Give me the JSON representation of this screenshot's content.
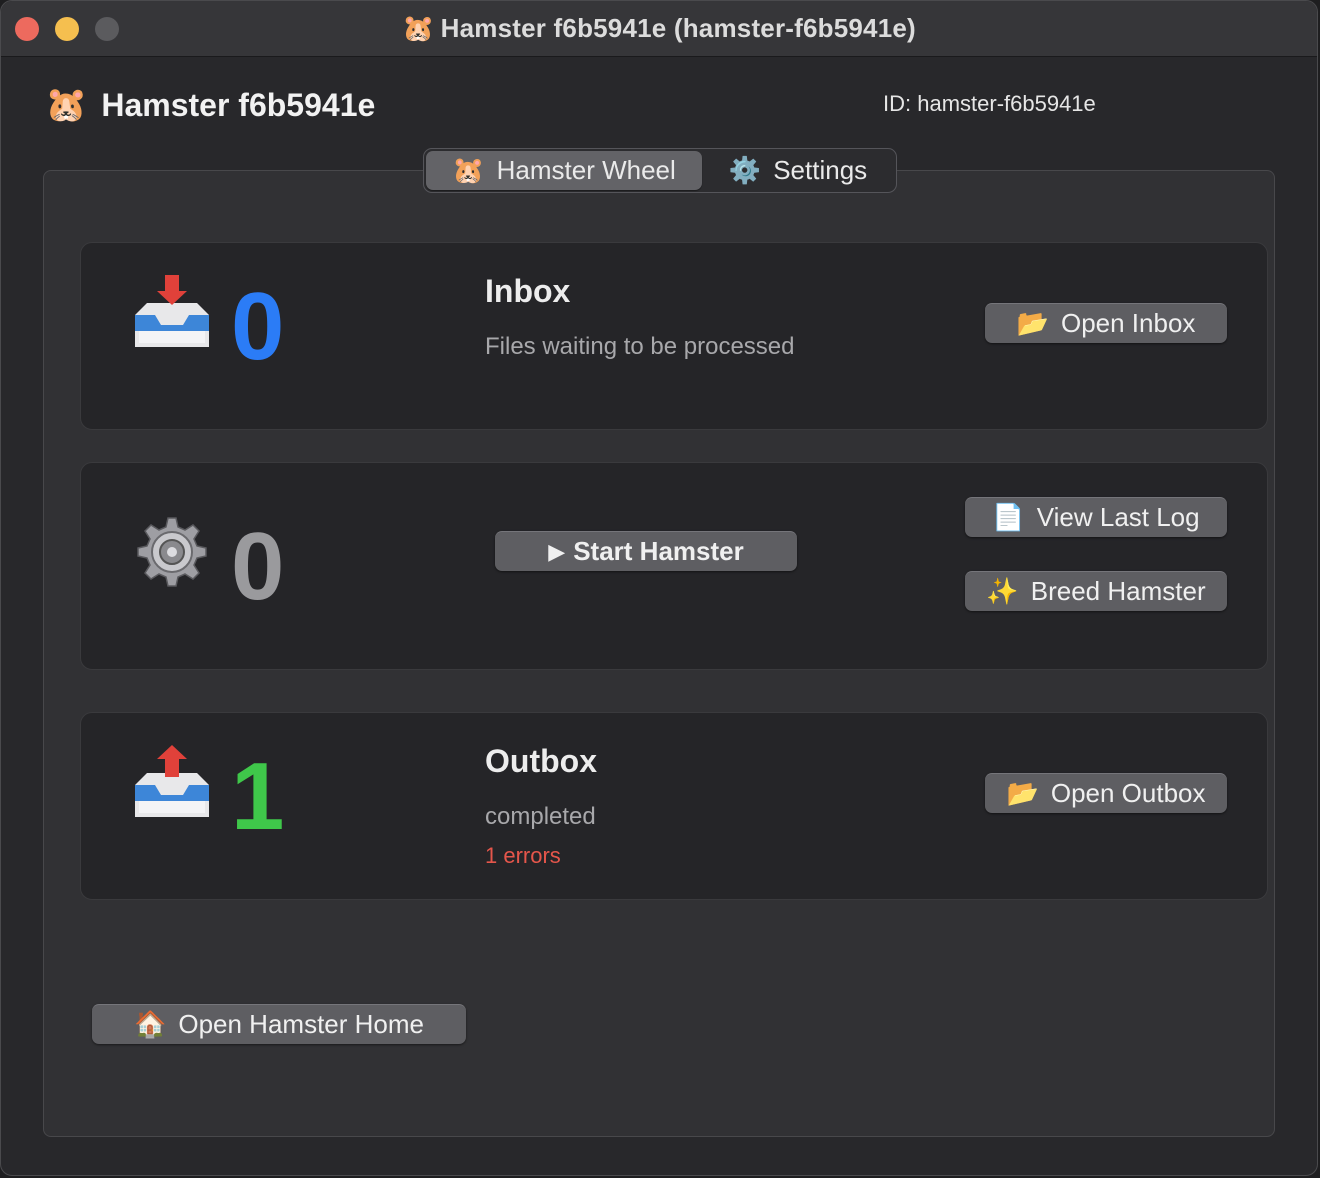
{
  "window": {
    "title": "Hamster f6b5941e (hamster-f6b5941e)",
    "title_icon": "🐹"
  },
  "header": {
    "icon": "🐹",
    "name": "Hamster f6b5941e",
    "id_label": "ID: hamster-f6b5941e"
  },
  "tabs": [
    {
      "icon": "🐹",
      "label": "Hamster Wheel",
      "active": true
    },
    {
      "icon": "⚙️",
      "label": "Settings",
      "active": false
    }
  ],
  "inbox": {
    "icon": "inbox-tray-icon",
    "count": "0",
    "count_color": "#2b7cf6",
    "title": "Inbox",
    "subtitle": "Files waiting to be processed",
    "button": {
      "icon": "📂",
      "label": "Open Inbox"
    }
  },
  "worker": {
    "icon": "gear-icon",
    "count": "0",
    "count_color": "#9a9a9d",
    "start_button": {
      "icon": "▶",
      "label": "Start Hamster"
    },
    "log_button": {
      "icon": "📄",
      "label": "View Last Log"
    },
    "breed_button": {
      "icon": "✨",
      "label": "Breed Hamster"
    }
  },
  "outbox": {
    "icon": "outbox-tray-icon",
    "count": "1",
    "count_color": "#3fc74a",
    "title": "Outbox",
    "subtitle": "completed",
    "errors": "1 errors",
    "button": {
      "icon": "📂",
      "label": "Open Outbox"
    }
  },
  "home_button": {
    "icon": "🏠",
    "label": "Open Hamster Home"
  },
  "colors": {
    "window_bg": "#28282b",
    "panel_bg": "#313134",
    "card_bg": "#252528",
    "error": "#e5564b"
  }
}
